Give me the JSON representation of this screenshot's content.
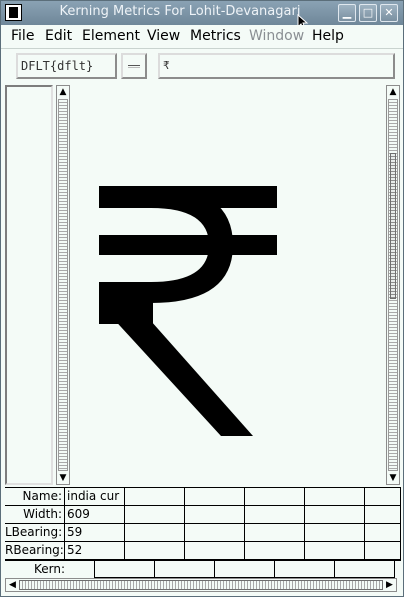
{
  "window": {
    "title": "Kerning Metrics For Lohit-Devanagari"
  },
  "titlebar_buttons": {
    "minimize": "▁",
    "maximize": "□",
    "close": "✕"
  },
  "menu": {
    "file": "File",
    "edit": "Edit",
    "element": "Element",
    "view": "View",
    "metrics": "Metrics",
    "window": "Window",
    "help": "Help"
  },
  "toolbar": {
    "script_lang": "DFLT{dflt}",
    "feature": "",
    "text": "₹"
  },
  "glyph": {
    "char": "₹"
  },
  "metrics": {
    "name_label": "Name:",
    "name_value": "india cur",
    "width_label": "Width:",
    "width_value": "609",
    "lbearing_label": "LBearing:",
    "lbearing_value": "59",
    "rbearing_label": "RBearing:",
    "rbearing_value": "52",
    "kern_label": "Kern:"
  },
  "scroll": {
    "vertical_thumb_position": 0.2,
    "horizontal_thumb_position": 0.0
  },
  "colors": {
    "titlebar": "#7b93a5",
    "background": "#f4fbf7",
    "glyph": "#000000"
  }
}
